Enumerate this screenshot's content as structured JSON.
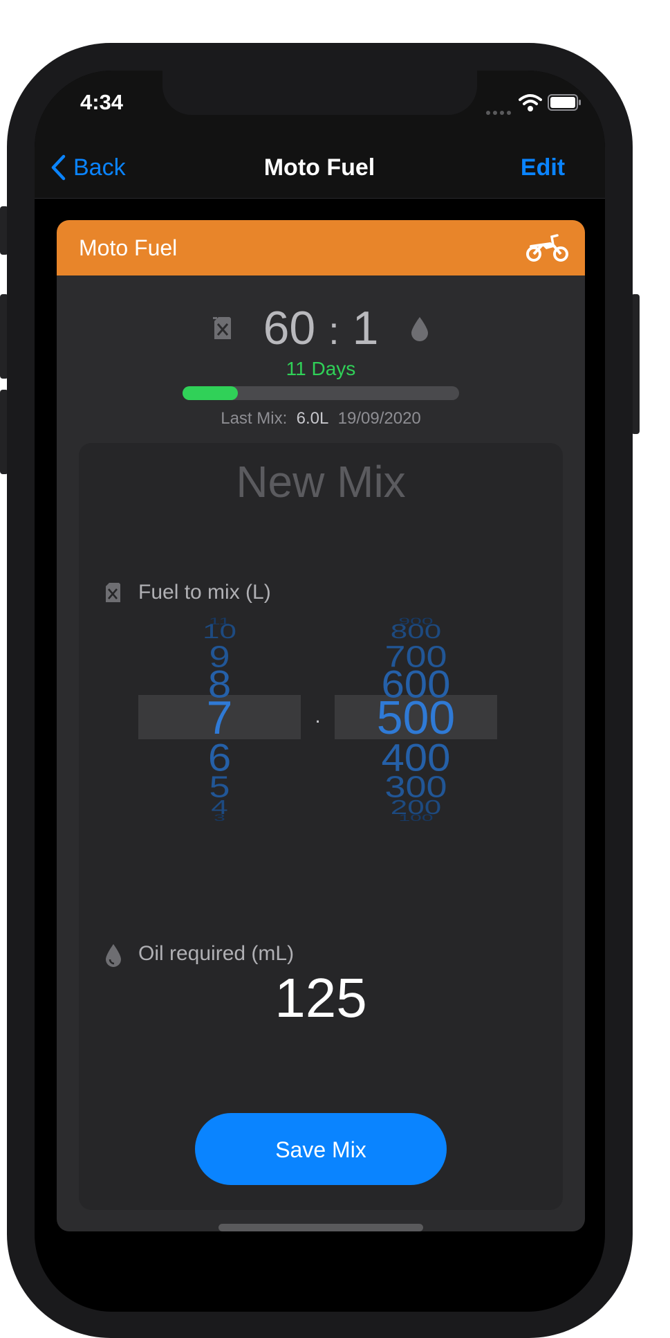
{
  "status_bar": {
    "time": "4:34"
  },
  "nav": {
    "back_label": "Back",
    "title": "Moto Fuel",
    "edit_label": "Edit"
  },
  "card": {
    "title": "Moto Fuel"
  },
  "ratio": {
    "fuel_part": "60",
    "separator": ":",
    "oil_part": "1"
  },
  "service": {
    "days_label": "11 Days",
    "progress_fraction": 0.2
  },
  "last_mix": {
    "label": "Last Mix:",
    "volume": "6.0L",
    "date": "19/09/2020"
  },
  "new_mix": {
    "title": "New Mix",
    "fuel_label": "Fuel to mix (L)",
    "liters_selected": "7",
    "liters_options": [
      "11",
      "10",
      "9",
      "8",
      "7",
      "6",
      "5",
      "4",
      "3"
    ],
    "decimal_separator": ".",
    "ml_selected": "500",
    "ml_options": [
      "900",
      "800",
      "700",
      "600",
      "500",
      "400",
      "300",
      "200",
      "100"
    ],
    "oil_label": "Oil required (mL)",
    "oil_value": "125",
    "save_label": "Save Mix"
  },
  "colors": {
    "accent": "#0a84ff",
    "header": "#e8852a",
    "success": "#30d158"
  },
  "icons": {
    "fuel": "fuel-can-icon",
    "oil": "oil-drop-icon",
    "bike": "motorbike-icon",
    "back": "chevron-left-icon"
  }
}
